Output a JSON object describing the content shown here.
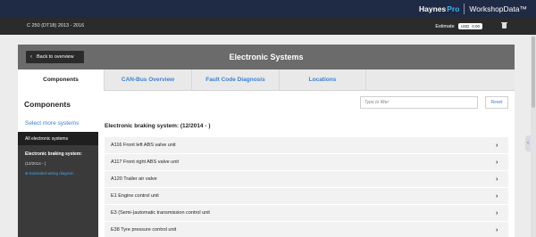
{
  "brand": {
    "haynes": "Haynes",
    "pro": "Pro",
    "workshop": "WorkshopData™"
  },
  "vehicle": "C 250 (DT18) 2013 - 2016",
  "estimate": {
    "label": "Estimate",
    "currency": "USD",
    "amount": "0.00"
  },
  "header": {
    "back_label": "Back to overview",
    "title": "Electronic Systems"
  },
  "tabs": [
    {
      "label": "Components",
      "active": true
    },
    {
      "label": "CAN-Bus Overview",
      "active": false
    },
    {
      "label": "Fault Code Diagnosis",
      "active": false
    },
    {
      "label": "Locations",
      "active": false
    }
  ],
  "components": {
    "title": "Components",
    "filter_placeholder": "Type to filter",
    "reset_label": "Reset"
  },
  "sidebar": {
    "select_more": "Select more systems",
    "all_systems": "All electronic systems",
    "system_name": "Electronic braking system:",
    "system_date": "(12/2014 - )",
    "wiring_link": "⊕ Extended wiring diagram"
  },
  "section_title": "Electronic braking system: (12/2014 - )",
  "items": [
    {
      "label": "A116 Front left ABS valve unit"
    },
    {
      "label": "A117 Front right ABS valve unit"
    },
    {
      "label": "A120 Trailer air valve"
    },
    {
      "label": "E1 Engine control unit"
    },
    {
      "label": "E3 (Semi-)automatic transmission control unit"
    },
    {
      "label": "E38 Tyre pressure control unit"
    }
  ],
  "icons": {
    "back": "chevron-left-icon",
    "row_arrow": "chevron-right-icon",
    "trash": "trash-icon",
    "side_tab": "chevron-left-icon"
  },
  "colors": {
    "topbar": "#1f2a44",
    "accent": "#3b7fd1",
    "header": "#6b6b6b"
  }
}
